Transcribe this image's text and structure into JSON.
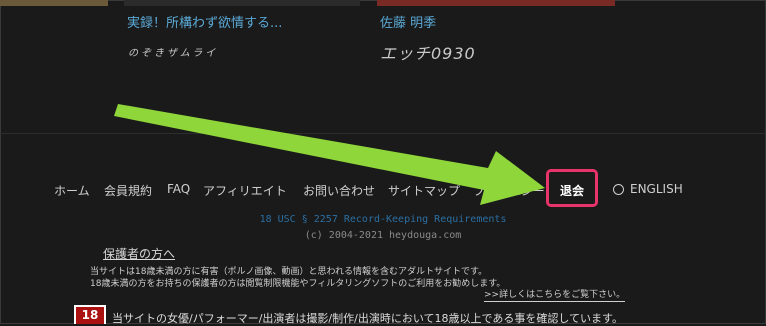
{
  "cards": [
    {
      "title": "実録！所構わず欲情する...",
      "logo": "のぞきザムライ"
    },
    {
      "title": "佐藤 明季",
      "logo": "エッチ0930"
    }
  ],
  "footer": {
    "nav": [
      "ホーム",
      "会員規約",
      "FAQ",
      "アフィリエイト",
      "お問い合わせ",
      "サイトマップ",
      "プライバシー",
      "退会",
      "ENGLISH"
    ],
    "usc_link": "18 USC § 2257 Record-Keeping Requirements",
    "copyright": "(c) 2004-2021 heydouga.com"
  },
  "guardian": {
    "title": "保護者の方へ",
    "line1": "当サイトは18歳未満の方に有害（ポルノ画像、動画）と思われる情報を含むアダルトサイトです。",
    "line2": "18歳未満の方をお持ちの保護者の方は閲覧制限機能やフィルタリングソフトのご利用をお勧めします。",
    "more_link": ">>詳しくはこちらをご覧下さい。"
  },
  "age_notice": {
    "badge": "18",
    "text": "当サイトの女優/パフォーマー/出演者は撮影/制作/出演時において18歳以上である事を確認しています。"
  },
  "colors": {
    "highlight": "#e8336b",
    "arrow": "#8fd63a",
    "link": "#5aa9d6"
  }
}
